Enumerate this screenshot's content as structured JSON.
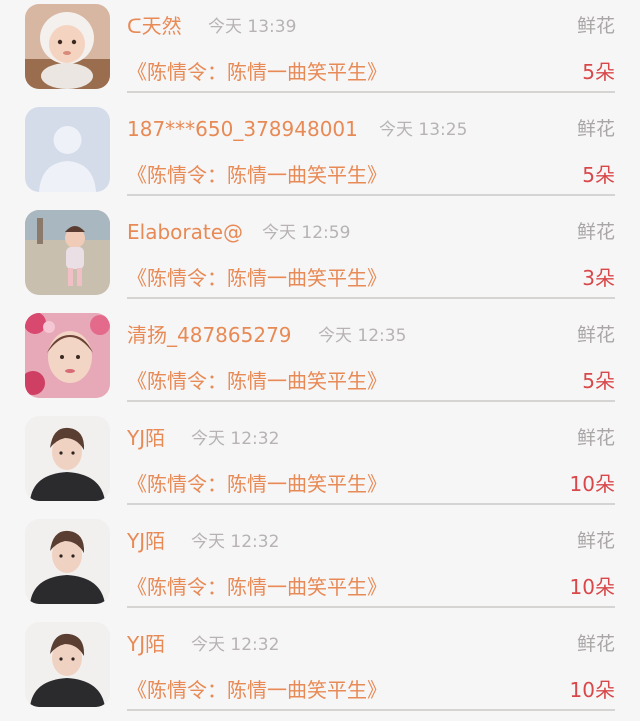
{
  "rows": [
    {
      "name": "ᑕ天然",
      "time": "今天 13:39",
      "gift": "鲜花",
      "work": "《陈情令：陈情一曲笑平生》",
      "count": "5朵",
      "avatar": "baby-photo-avatar"
    },
    {
      "name": "187***650_378948001",
      "time": "今天 13:25",
      "gift": "鲜花",
      "work": "《陈情令：陈情一曲笑平生》",
      "count": "5朵",
      "avatar": "default-user-avatar"
    },
    {
      "name": "Elaborate@",
      "time": "今天 12:59",
      "gift": "鲜花",
      "work": "《陈情令：陈情一曲笑平生》",
      "count": "3朵",
      "avatar": "child-beach-avatar"
    },
    {
      "name": "清扬_487865279",
      "time": "今天 12:35",
      "gift": "鲜花",
      "work": "《陈情令：陈情一曲笑平生》",
      "count": "5朵",
      "avatar": "flower-woman-avatar"
    },
    {
      "name": "YJ陌",
      "time": "今天 12:32",
      "gift": "鲜花",
      "work": "《陈情令：陈情一曲笑平生》",
      "count": "10朵",
      "avatar": "young-man-avatar"
    },
    {
      "name": "YJ陌",
      "time": "今天 12:32",
      "gift": "鲜花",
      "work": "《陈情令：陈情一曲笑平生》",
      "count": "10朵",
      "avatar": "young-man-avatar"
    },
    {
      "name": "YJ陌",
      "time": "今天 12:32",
      "gift": "鲜花",
      "work": "《陈情令：陈情一曲笑平生》",
      "count": "10朵",
      "avatar": "young-man-avatar"
    }
  ],
  "colors": {
    "name": "#e88a55",
    "count": "#d8484a",
    "muted": "#b7b3b3",
    "background": "#f7f6f7"
  }
}
